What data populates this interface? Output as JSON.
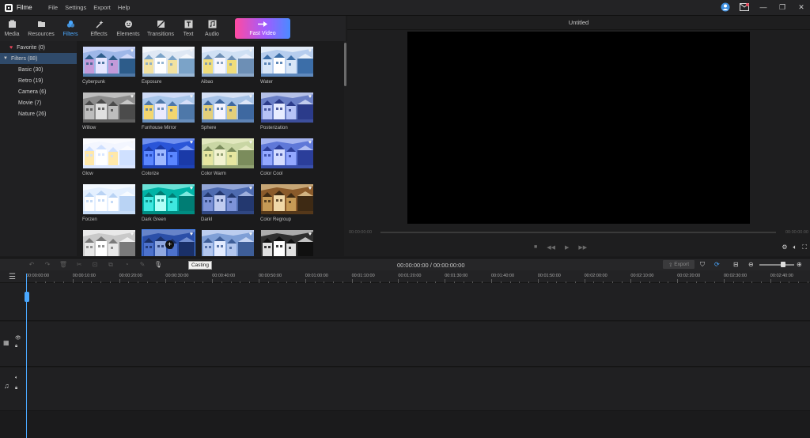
{
  "app": {
    "name": "Filme",
    "menu": [
      "File",
      "Settings",
      "Export",
      "Help"
    ]
  },
  "toolbar": {
    "tabs": [
      {
        "label": "Media",
        "icon": "media-icon"
      },
      {
        "label": "Resources",
        "icon": "folder-icon"
      },
      {
        "label": "Filters",
        "icon": "filters-icon",
        "active": true
      },
      {
        "label": "Effects",
        "icon": "effects-icon"
      },
      {
        "label": "Elements",
        "icon": "elements-icon"
      },
      {
        "label": "Transitions",
        "icon": "transitions-icon"
      },
      {
        "label": "Text",
        "icon": "text-icon"
      },
      {
        "label": "Audio",
        "icon": "audio-icon"
      }
    ],
    "fast_video": "Fast Video"
  },
  "sidebar": {
    "favorite": "Favorite (0)",
    "filters": "Filters (88)",
    "items": [
      "Basic (30)",
      "Retro (19)",
      "Camera (6)",
      "Movie (7)",
      "Nature (26)"
    ]
  },
  "filters": [
    "Cyberpunk",
    "Exposure",
    "Aibao",
    "Water",
    "Willow",
    "Funhouse Mirror",
    "Sphere",
    "Posterization",
    "Glow",
    "Colorize",
    "Color Warm",
    "Color Cool",
    "Forzen",
    "Dark Green",
    "DarkI",
    "Color Regroup"
  ],
  "preview": {
    "title": "Untitled",
    "time_left": "00:00:00:00",
    "time_right": "00:00:00:00"
  },
  "timeline": {
    "timecode": "00:00:00:00 / 00:00:00:00",
    "export_label": "Export",
    "tooltip": "Casting",
    "ruler": [
      "00:00:00:00",
      "00:00:10:00",
      "00:00:20:00",
      "00:00:30:00",
      "00:00:40:00",
      "00:00:50:00",
      "00:01:00:00",
      "00:01:10:00",
      "00:01:20:00",
      "00:01:30:00",
      "00:01:40:00",
      "00:01:50:00",
      "00:02:00:00",
      "00:02:10:00",
      "00:02:20:00",
      "00:02:30:00",
      "00:02:40:00"
    ]
  },
  "colors": {
    "accent": "#4aa8ff",
    "heart": "#e8465a"
  }
}
